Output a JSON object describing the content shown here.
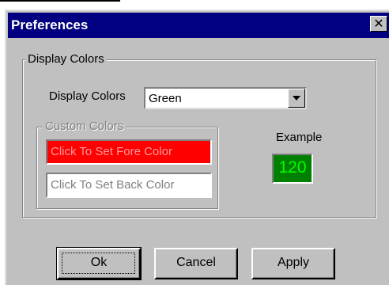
{
  "window": {
    "title": "Preferences",
    "close_glyph": "✕"
  },
  "display_colors_group": {
    "legend": "Display Colors",
    "combo_label": "Display Colors",
    "combo_value": "Green"
  },
  "custom_colors_group": {
    "legend": "Custom Colors",
    "fore_button_label": "Click To Set Fore Color",
    "back_button_label": "Click To Set Back Color"
  },
  "example": {
    "label": "Example",
    "value": "120"
  },
  "buttons": {
    "ok": "Ok",
    "cancel": "Cancel",
    "apply": "Apply"
  },
  "colors": {
    "title_bar": "#000080",
    "dialog_face": "#c0c0c0",
    "fore_color_swatch": "#ff0000",
    "example_background": "#008000",
    "example_text": "#00ff00"
  }
}
